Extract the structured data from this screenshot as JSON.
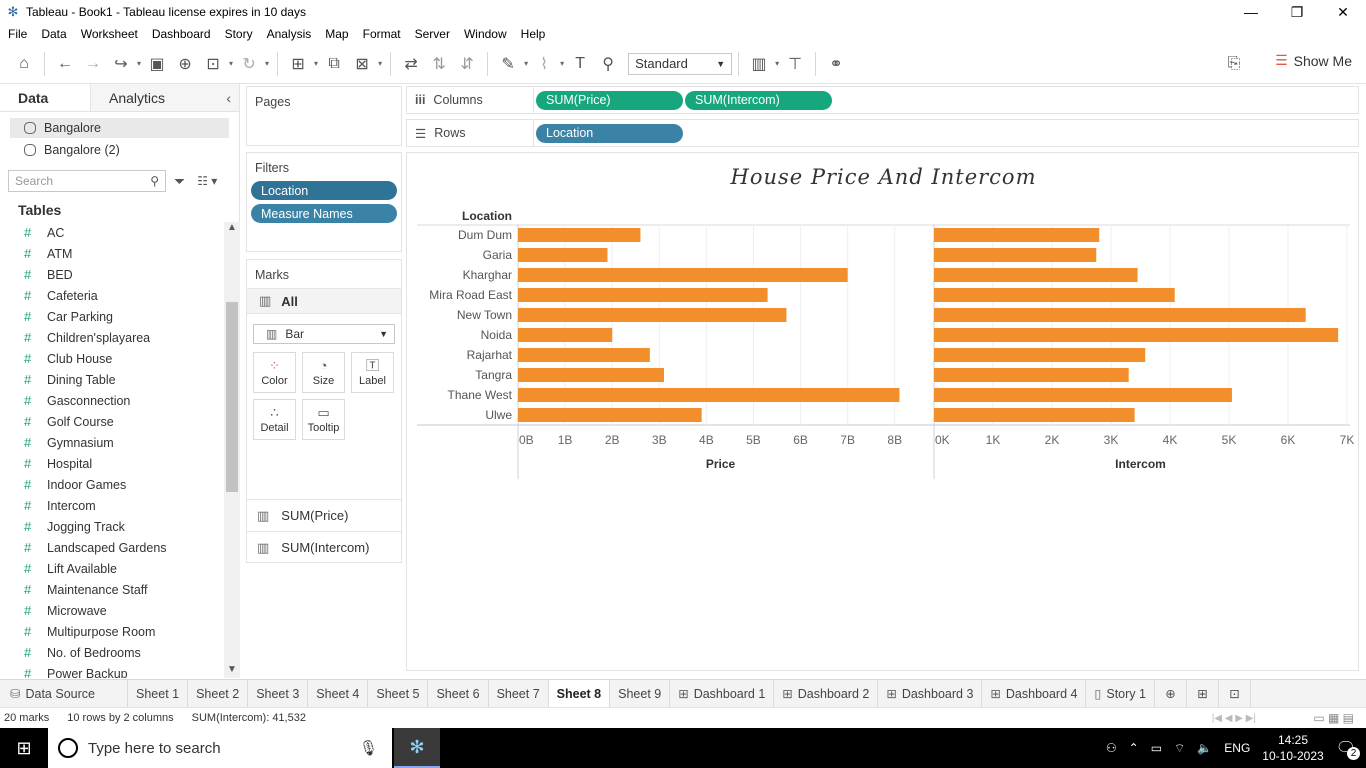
{
  "window": {
    "title": "Tableau - Book1 - Tableau license expires in 10 days"
  },
  "menu": [
    "File",
    "Data",
    "Worksheet",
    "Dashboard",
    "Story",
    "Analysis",
    "Map",
    "Format",
    "Server",
    "Window",
    "Help"
  ],
  "toolbar": {
    "fit": "Standard",
    "show_me": "Show Me"
  },
  "data_pane": {
    "tab_data": "Data",
    "tab_analytics": "Analytics",
    "sources": [
      "Bangalore",
      "Bangalore (2)"
    ],
    "search_placeholder": "Search",
    "tables_label": "Tables",
    "fields": [
      "AC",
      "ATM",
      "BED",
      "Cafeteria",
      "Car Parking",
      "Children'splayarea",
      "Club House",
      "Dining Table",
      "Gasconnection",
      "Golf Course",
      "Gymnasium",
      "Hospital",
      "Indoor Games",
      "Intercom",
      "Jogging Track",
      "Landscaped Gardens",
      "Lift Available",
      "Maintenance Staff",
      "Microwave",
      "Multipurpose Room",
      "No. of Bedrooms",
      "Power Backup"
    ]
  },
  "cards": {
    "pages": "Pages",
    "filters": "Filters",
    "filter_pills": [
      "Location",
      "Measure Names"
    ],
    "marks": "Marks",
    "marks_all": "All",
    "mark_type": "Bar",
    "mark_buttons": [
      "Color",
      "Size",
      "Label",
      "Detail",
      "Tooltip"
    ],
    "measures": [
      "SUM(Price)",
      "SUM(Intercom)"
    ]
  },
  "shelves": {
    "columns_label": "Columns",
    "rows_label": "Rows",
    "columns": [
      "SUM(Price)",
      "SUM(Intercom)"
    ],
    "rows": [
      "Location"
    ]
  },
  "chart_data": {
    "type": "bar",
    "title": "House Price And Intercom",
    "row_header": "Location",
    "bar_color": "#f28e2b",
    "categories": [
      "Dum Dum",
      "Garia",
      "Kharghar",
      "Mira Road East",
      "New Town",
      "Noida",
      "Rajarhat",
      "Tangra",
      "Thane West",
      "Ulwe"
    ],
    "series": [
      {
        "name": "Price",
        "values": [
          2600000000,
          1900000000,
          7000000000,
          5300000000,
          5700000000,
          2000000000,
          2800000000,
          3100000000,
          8100000000,
          3900000000
        ],
        "xlim": [
          0,
          8600000000
        ],
        "ticks": [
          "0B",
          "1B",
          "2B",
          "3B",
          "4B",
          "5B",
          "6B",
          "7B",
          "8B"
        ],
        "tick_values": [
          0,
          1000000000,
          2000000000,
          3000000000,
          4000000000,
          5000000000,
          6000000000,
          7000000000,
          8000000000
        ]
      },
      {
        "name": "Intercom",
        "values": [
          2800,
          2750,
          3450,
          4080,
          6300,
          6850,
          3580,
          3300,
          5050,
          3400
        ],
        "xlim": [
          0,
          7000
        ],
        "ticks": [
          "0K",
          "1K",
          "2K",
          "3K",
          "4K",
          "5K",
          "6K",
          "7K"
        ],
        "tick_values": [
          0,
          1000,
          2000,
          3000,
          4000,
          5000,
          6000,
          7000
        ]
      }
    ]
  },
  "tabs": [
    "Data Source",
    "Sheet 1",
    "Sheet 2",
    "Sheet 3",
    "Sheet 4",
    "Sheet 5",
    "Sheet 6",
    "Sheet 7",
    "Sheet 8",
    "Sheet 9",
    "Dashboard 1",
    "Dashboard 2",
    "Dashboard 3",
    "Dashboard 4",
    "Story 1"
  ],
  "active_tab": "Sheet 8",
  "status": {
    "marks": "20 marks",
    "rows_cols": "10 rows by 2 columns",
    "sum": "SUM(Intercom): 41,532"
  },
  "taskbar": {
    "search_placeholder": "Type here to search",
    "lang": "ENG",
    "time": "14:25",
    "date": "10-10-2023",
    "notif_count": "2"
  }
}
